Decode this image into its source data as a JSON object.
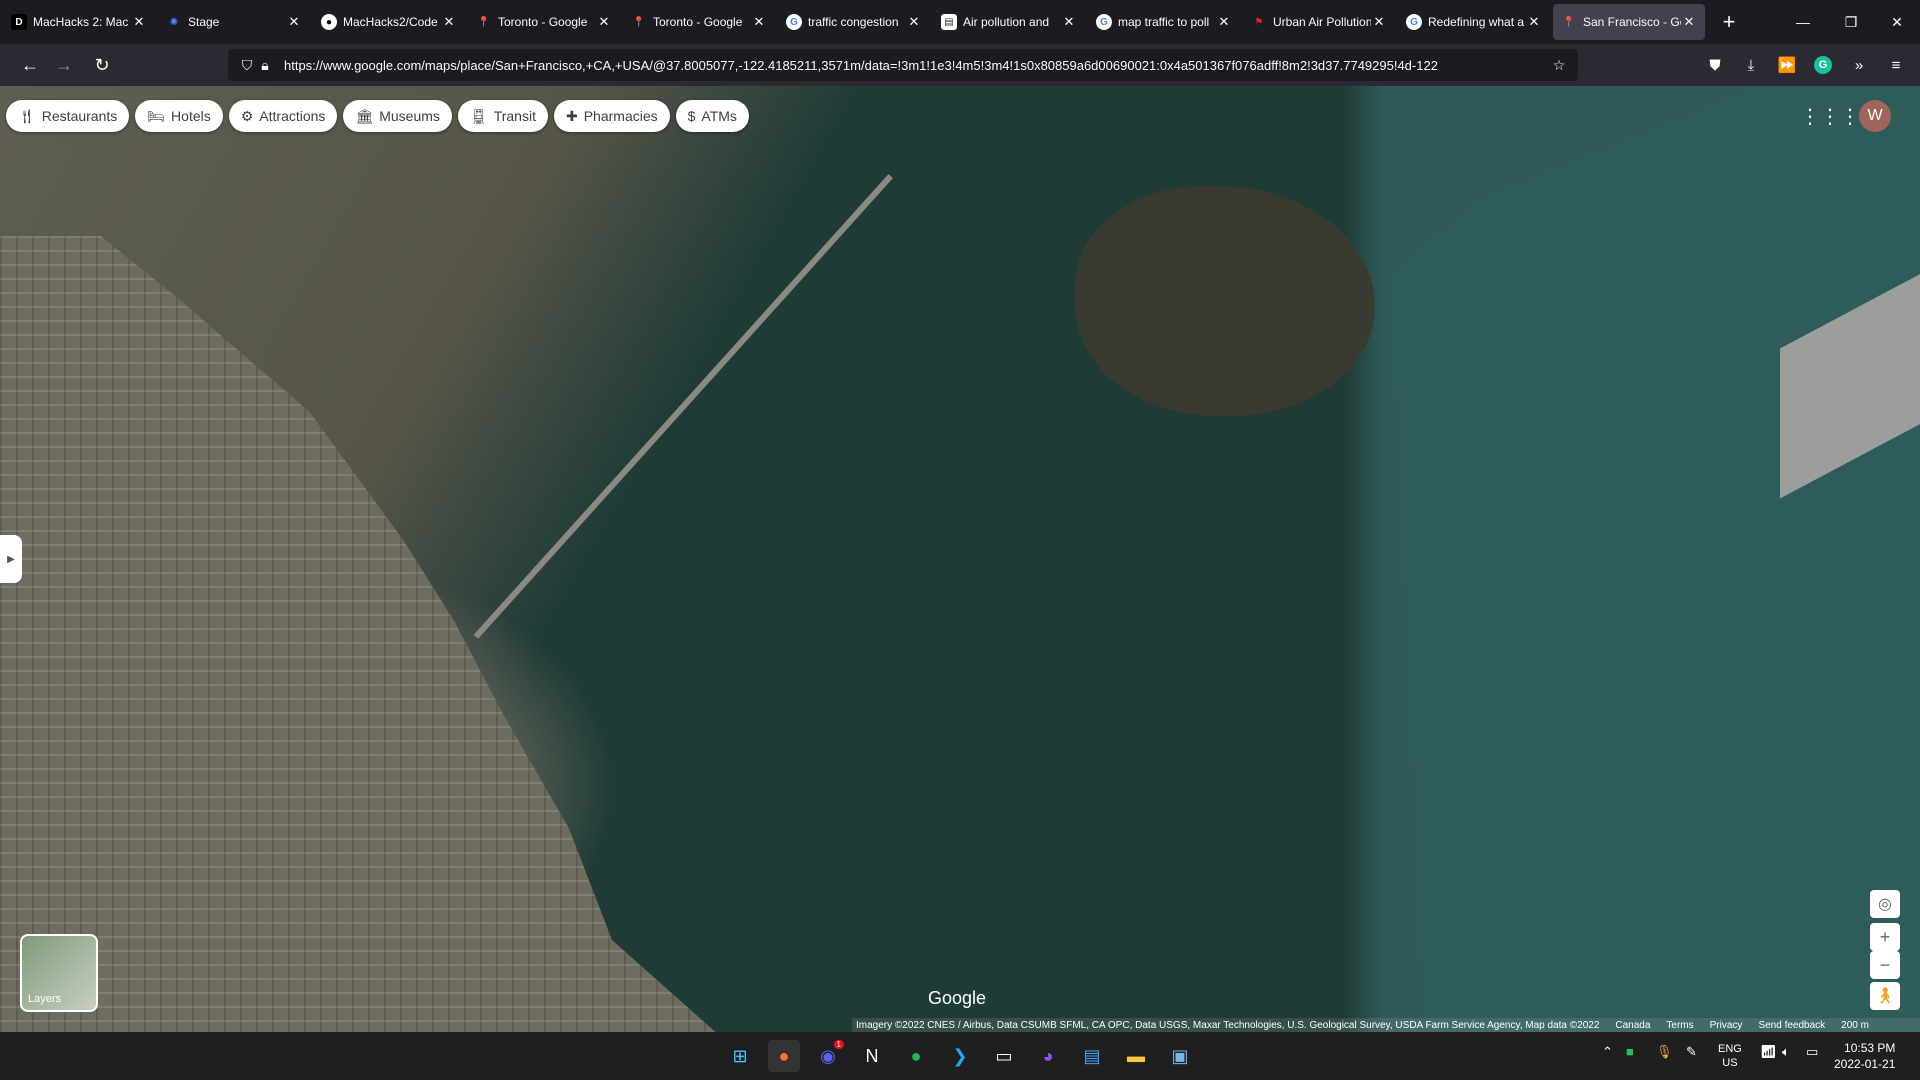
{
  "browser": {
    "tabs": [
      {
        "title": "MacHacks 2: Mac",
        "icon": "d-letter-icon",
        "active": false
      },
      {
        "title": "Stage",
        "icon": "stage-icon",
        "active": false
      },
      {
        "title": "MacHacks2/Code",
        "icon": "github-icon",
        "active": false
      },
      {
        "title": "Toronto - Google",
        "icon": "maps-pin-icon",
        "active": false
      },
      {
        "title": "Toronto - Google",
        "icon": "maps-pin-icon",
        "active": false
      },
      {
        "title": "traffic congestion",
        "icon": "google-icon",
        "active": false
      },
      {
        "title": "Air pollution and",
        "icon": "doc-icon",
        "active": false
      },
      {
        "title": "map traffic to poll",
        "icon": "google-icon",
        "active": false
      },
      {
        "title": "Urban Air Pollution",
        "icon": "flag-icon",
        "active": false
      },
      {
        "title": "Redefining what a",
        "icon": "google-icon",
        "active": false
      },
      {
        "title": "San Francisco - Go",
        "icon": "maps-pin-icon",
        "active": true
      }
    ],
    "url": "https://www.google.com/maps/place/San+Francisco,+CA,+USA/@37.8005077,-122.4185211,3571m/data=!3m1!1e3!4m5!3m4!1s0x80859a6d00690021:0x4a501367f076adff!8m2!3d37.7749295!4d-122"
  },
  "map": {
    "categories": [
      {
        "label": "Restaurants",
        "icon": "restaurant-icon"
      },
      {
        "label": "Hotels",
        "icon": "hotel-icon"
      },
      {
        "label": "Attractions",
        "icon": "attractions-icon"
      },
      {
        "label": "Museums",
        "icon": "museum-icon"
      },
      {
        "label": "Transit",
        "icon": "transit-icon"
      },
      {
        "label": "Pharmacies",
        "icon": "pharmacy-icon"
      },
      {
        "label": "ATMs",
        "icon": "atm-icon"
      }
    ],
    "avatar_letter": "W",
    "layers_label": "Layers",
    "logo_text": "Google",
    "attribution": "Imagery ©2022 CNES / Airbus, Data CSUMB SFML, CA OPC, Data USGS, Maxar Technologies, U.S. Geological Survey, USDA Farm Service Agency, Map data ©2022",
    "footer_links": [
      "Canada",
      "Terms",
      "Privacy",
      "Send feedback"
    ],
    "scale_label": "200 m"
  },
  "taskbar": {
    "notification_count": "1",
    "language_line1": "ENG",
    "language_line2": "US",
    "time": "10:53 PM",
    "date": "2022-01-21"
  },
  "colors": {
    "chrome_bg": "#1c1b22",
    "toolbar_bg": "#2b2a33",
    "water": "#1f3b37",
    "avatar": "#a0645a"
  }
}
